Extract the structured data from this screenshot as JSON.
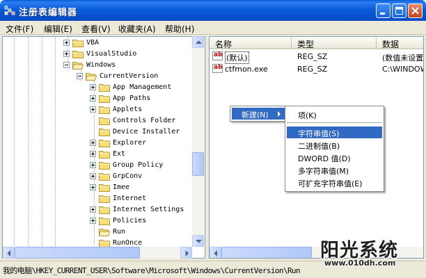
{
  "window": {
    "title": "注册表编辑器"
  },
  "menu": [
    "文件(F)",
    "编辑(E)",
    "查看(V)",
    "收藏夹(A)",
    "帮助(H)"
  ],
  "tree": [
    {
      "label": "VBA",
      "expander": "plus"
    },
    {
      "label": "VisualStudio",
      "expander": "plus"
    },
    {
      "label": "Windows",
      "expander": "minus"
    },
    {
      "label": "CurrentVersion",
      "expander": "minus"
    },
    {
      "label": "App Management",
      "expander": "plus"
    },
    {
      "label": "App Paths",
      "expander": "plus"
    },
    {
      "label": "Applets",
      "expander": "plus"
    },
    {
      "label": "Controls Folder",
      "expander": "none"
    },
    {
      "label": "Device Installer",
      "expander": "none"
    },
    {
      "label": "Explorer",
      "expander": "plus"
    },
    {
      "label": "Ext",
      "expander": "plus"
    },
    {
      "label": "Group Policy",
      "expander": "plus"
    },
    {
      "label": "GrpConv",
      "expander": "plus"
    },
    {
      "label": "Imee",
      "expander": "plus"
    },
    {
      "label": "Internet",
      "expander": "none"
    },
    {
      "label": "Internet Settings",
      "expander": "plus"
    },
    {
      "label": "Policies",
      "expander": "plus"
    },
    {
      "label": "Run",
      "expander": "none"
    },
    {
      "label": "RunOnce",
      "expander": "none"
    }
  ],
  "list": {
    "columns": [
      "名称",
      "类型",
      "数据"
    ],
    "rows": [
      {
        "name": "(默认)",
        "type": "REG_SZ",
        "data": "(数值未设置"
      },
      {
        "name": "ctfmon.exe",
        "type": "REG_SZ",
        "data": "C:\\WINDOWS"
      }
    ]
  },
  "context_menu": {
    "parent": "新建(N)",
    "items": [
      "项(K)",
      "字符串值(S)",
      "二进制值(B)",
      "DWORD 值(D)",
      "多字符串值(M)",
      "可扩充字符串值(E)"
    ],
    "highlighted": "字符串值(S)"
  },
  "status": "我的电脑\\HKEY_CURRENT_USER\\Software\\Microsoft\\Windows\\CurrentVersion\\Run",
  "watermark": {
    "text": "阳光系统",
    "url": "www.010dh.com"
  },
  "colors": {
    "titlebar": "#0a5fd8",
    "highlight": "#316ac5",
    "menubar": "#ece9d8"
  }
}
